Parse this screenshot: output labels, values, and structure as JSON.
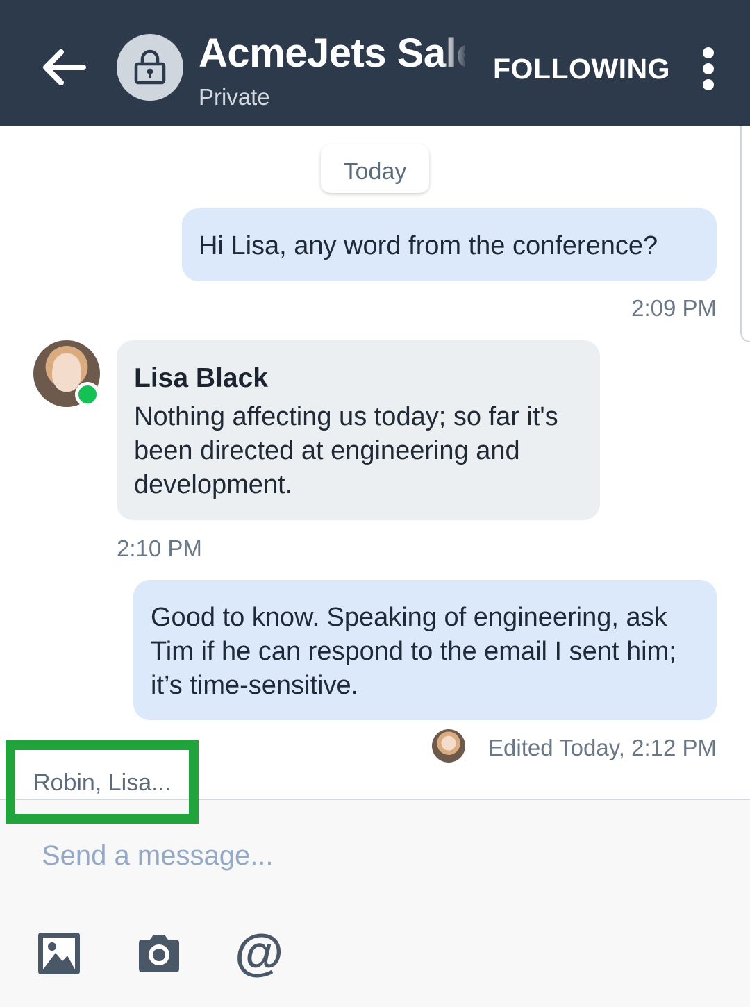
{
  "header": {
    "title": "AcmeJets Sales",
    "subtitle": "Private",
    "follow_label": "FOLLOWING",
    "icons": {
      "back": "back-arrow-icon",
      "room": "lock-icon",
      "more": "more-vertical-icon"
    },
    "background_color": "#2d3a4b"
  },
  "conversation": {
    "day_divider": "Today",
    "messages": [
      {
        "direction": "outgoing",
        "text": "Hi Lisa, any word from the conference?",
        "time": "2:09 PM"
      },
      {
        "direction": "incoming",
        "sender": "Lisa Black",
        "text": "Nothing affecting us today; so far it's been directed at engineering and development.",
        "time": "2:10 PM",
        "presence": "online"
      },
      {
        "direction": "outgoing",
        "text": "Good to know. Speaking of engineering, ask Tim if he can respond to the email I sent him; it’s time-sensitive.",
        "time": "Edited Today, 2:12 PM"
      }
    ],
    "typing_indicator": "Robin, Lisa..."
  },
  "composer": {
    "placeholder": "Send a message...",
    "tools": [
      "image-icon",
      "camera-icon",
      "at-mention-icon"
    ],
    "mention_symbol": "@"
  },
  "colors": {
    "outgoing_bubble": "#dbe9fb",
    "incoming_bubble": "#eceff2",
    "online": "#14c153",
    "highlight_box": "#20a43b"
  }
}
